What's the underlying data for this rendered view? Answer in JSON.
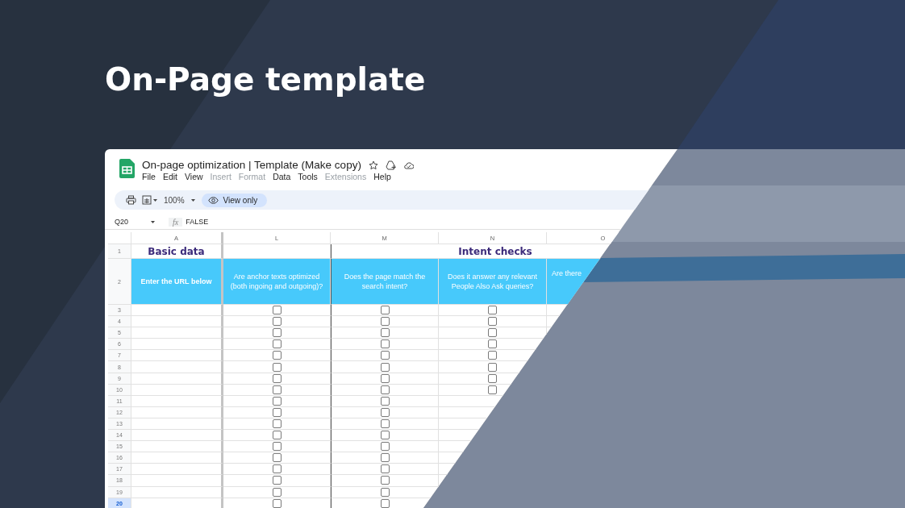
{
  "title": "On-Page template",
  "sheet": {
    "doc_title": "On-page optimization | Template (Make copy)",
    "menu": [
      {
        "label": "File",
        "disabled": false
      },
      {
        "label": "Edit",
        "disabled": false
      },
      {
        "label": "View",
        "disabled": false
      },
      {
        "label": "Insert",
        "disabled": true
      },
      {
        "label": "Format",
        "disabled": true
      },
      {
        "label": "Data",
        "disabled": false
      },
      {
        "label": "Tools",
        "disabled": false
      },
      {
        "label": "Extensions",
        "disabled": true
      },
      {
        "label": "Help",
        "disabled": false
      }
    ],
    "zoom": "100%",
    "mode": "View only",
    "name_box": "Q20",
    "formula_icon": "fx",
    "formula": "FALSE",
    "columns": [
      "A",
      "L",
      "M",
      "N",
      "O"
    ],
    "header_rows": [
      "1",
      "2"
    ],
    "groups": [
      "Basic data",
      "Intent checks"
    ],
    "headers": [
      "Enter the URL below",
      "Are anchor texts optimized (both ingoing and outgoing)?",
      "Does the page match the search intent?",
      "Does it answer any relevant People Also Ask queries?",
      "Are there"
    ],
    "rows": [
      {
        "number": "3",
        "selected": false,
        "checks": [
          false,
          false,
          false
        ]
      },
      {
        "number": "4",
        "selected": false,
        "checks": [
          false,
          false,
          false
        ]
      },
      {
        "number": "5",
        "selected": false,
        "checks": [
          false,
          false,
          false
        ]
      },
      {
        "number": "6",
        "selected": false,
        "checks": [
          false,
          false,
          false
        ]
      },
      {
        "number": "7",
        "selected": false,
        "checks": [
          false,
          false,
          false
        ]
      },
      {
        "number": "8",
        "selected": false,
        "checks": [
          false,
          false,
          false
        ]
      },
      {
        "number": "9",
        "selected": false,
        "checks": [
          false,
          false,
          false
        ]
      },
      {
        "number": "10",
        "selected": false,
        "checks": [
          false,
          false,
          false
        ]
      },
      {
        "number": "11",
        "selected": false,
        "checks": [
          false,
          false
        ]
      },
      {
        "number": "12",
        "selected": false,
        "checks": [
          false,
          false
        ]
      },
      {
        "number": "13",
        "selected": false,
        "checks": [
          false,
          false
        ]
      },
      {
        "number": "14",
        "selected": false,
        "checks": [
          false,
          false
        ]
      },
      {
        "number": "15",
        "selected": false,
        "checks": [
          false,
          false
        ]
      },
      {
        "number": "16",
        "selected": false,
        "checks": [
          false,
          false
        ]
      },
      {
        "number": "17",
        "selected": false,
        "checks": [
          false,
          false
        ]
      },
      {
        "number": "18",
        "selected": false,
        "checks": [
          false,
          false
        ]
      },
      {
        "number": "19",
        "selected": false,
        "checks": [
          false,
          false
        ]
      },
      {
        "number": "20",
        "selected": true,
        "checks": [
          false,
          false
        ]
      }
    ]
  }
}
